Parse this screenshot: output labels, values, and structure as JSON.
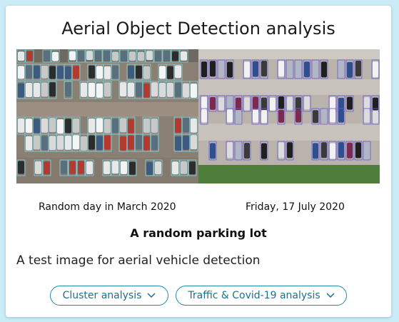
{
  "card": {
    "title": "Aerial Object Detection analysis",
    "images": [
      {
        "alt": "aerial-parking-lot-march-2020",
        "caption": "Random day in March 2020"
      },
      {
        "alt": "aerial-parking-lot-july-2020",
        "caption": "Friday, 17 July 2020"
      }
    ],
    "subtitle": "A random parking lot",
    "description": "A test image for aerial vehicle detection",
    "buttons": [
      {
        "label": "Cluster analysis",
        "icon": "chevron-down-icon"
      },
      {
        "label": "Traffic & Covid-19 analysis",
        "icon": "chevron-down-icon"
      }
    ]
  },
  "colors": {
    "page_background": "#c9ecf6",
    "accent": "#1f8aa5",
    "button_text": "#19718a"
  }
}
